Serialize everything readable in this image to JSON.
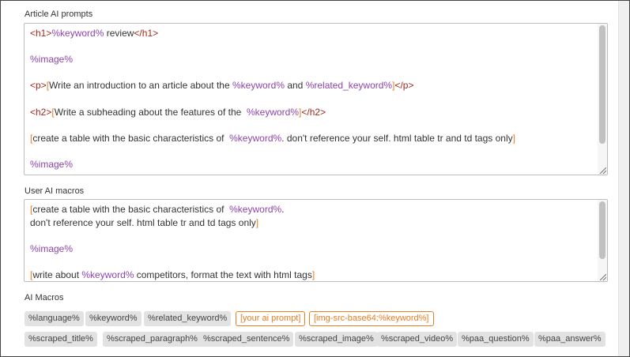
{
  "article_prompts": {
    "label": "Article AI prompts",
    "lines": [
      [
        {
          "c": "tag",
          "t": "<h1>"
        },
        {
          "c": "var",
          "t": "%keyword%"
        },
        {
          "c": "txt",
          "t": " review"
        },
        {
          "c": "tag",
          "t": "</h1>"
        }
      ],
      [],
      [
        {
          "c": "var",
          "t": "%image%"
        }
      ],
      [],
      [
        {
          "c": "tag",
          "t": "<p>"
        },
        {
          "c": "br",
          "t": "["
        },
        {
          "c": "txt",
          "t": "Write an introduction to an article about the "
        },
        {
          "c": "var",
          "t": "%keyword%"
        },
        {
          "c": "txt",
          "t": " and "
        },
        {
          "c": "var",
          "t": "%related_keyword%"
        },
        {
          "c": "br",
          "t": "]"
        },
        {
          "c": "tag",
          "t": "</p>"
        }
      ],
      [],
      [
        {
          "c": "tag",
          "t": "<h2>"
        },
        {
          "c": "br",
          "t": "["
        },
        {
          "c": "txt",
          "t": "Write a subheading about the features of the  "
        },
        {
          "c": "var",
          "t": "%keyword%"
        },
        {
          "c": "br",
          "t": "]"
        },
        {
          "c": "tag",
          "t": "</h2>"
        }
      ],
      [],
      [
        {
          "c": "br",
          "t": "["
        },
        {
          "c": "txt",
          "t": "create a table with the basic characteristics of  "
        },
        {
          "c": "var",
          "t": "%keyword%"
        },
        {
          "c": "txt",
          "t": ". don't reference your self. html table tr and td tags only"
        },
        {
          "c": "br",
          "t": "]"
        }
      ],
      [],
      [
        {
          "c": "var",
          "t": "%image%"
        }
      ]
    ]
  },
  "user_macros": {
    "label": "User AI macros",
    "lines": [
      [
        {
          "c": "br",
          "t": "["
        },
        {
          "c": "txt",
          "t": "create a table with the basic characteristics of  "
        },
        {
          "c": "var",
          "t": "%keyword%"
        },
        {
          "c": "txt",
          "t": "."
        }
      ],
      [
        {
          "c": "txt",
          "t": "don't reference your self. html table tr and td tags only"
        },
        {
          "c": "br",
          "t": "]"
        }
      ],
      [],
      [
        {
          "c": "var",
          "t": "%image%"
        }
      ],
      [],
      [
        {
          "c": "br",
          "t": "["
        },
        {
          "c": "txt",
          "t": "write about "
        },
        {
          "c": "var",
          "t": "%keyword%"
        },
        {
          "c": "txt",
          "t": " competitors, format the text with html tags"
        },
        {
          "c": "br",
          "t": "]"
        }
      ]
    ]
  },
  "ai_macros": {
    "label": "AI Macros",
    "chips": [
      {
        "label": "%language%",
        "style": "gray"
      },
      {
        "label": "%keyword%",
        "style": "gray"
      },
      {
        "label": "%related_keyword%",
        "style": "gray"
      },
      {
        "label": "[your ai prompt]",
        "style": "orange"
      },
      {
        "label": "[img-src-base64:%keyword%]",
        "style": "orange"
      },
      {
        "label": "%scraped_title%",
        "style": "gray"
      },
      {
        "label": "%scraped_paragraph%",
        "style": "gray"
      },
      {
        "label": "%scraped_sentence%",
        "style": "gray"
      },
      {
        "label": "%scraped_image%",
        "style": "gray"
      },
      {
        "label": "%scraped_video%",
        "style": "gray"
      },
      {
        "label": "%paa_question%",
        "style": "gray"
      },
      {
        "label": "%paa_answer%",
        "style": "gray"
      }
    ]
  }
}
